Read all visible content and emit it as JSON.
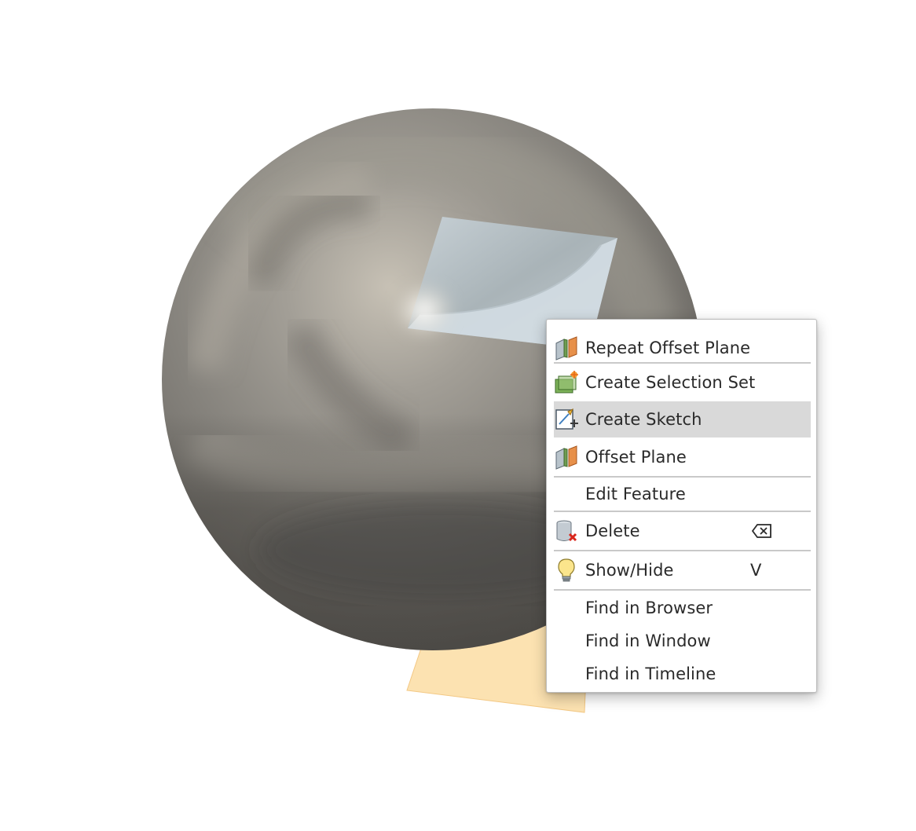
{
  "scene": {
    "sphere_color": "#8a8780",
    "sketch_plane_color": "#d3dde3",
    "offset_plane_color": "#fcdda3"
  },
  "context_menu": {
    "items": [
      {
        "label": "Repeat Offset Plane",
        "icon": "offset-plane-icon"
      },
      {
        "label": "Create Selection Set",
        "icon": "selection-set-icon"
      },
      {
        "label": "Create Sketch",
        "icon": "create-sketch-icon",
        "highlighted": true
      },
      {
        "label": "Offset Plane",
        "icon": "offset-plane-icon"
      },
      {
        "label": "Edit Feature",
        "icon": ""
      },
      {
        "label": "Delete",
        "icon": "delete-icon",
        "shortcut_icon": "delete-key-icon"
      },
      {
        "label": "Show/Hide",
        "icon": "lightbulb-icon",
        "shortcut": "V"
      },
      {
        "label": "Find in Browser",
        "icon": ""
      },
      {
        "label": "Find in Window",
        "icon": ""
      },
      {
        "label": "Find in Timeline",
        "icon": ""
      }
    ],
    "highlight_color": "#d9d9d9"
  }
}
